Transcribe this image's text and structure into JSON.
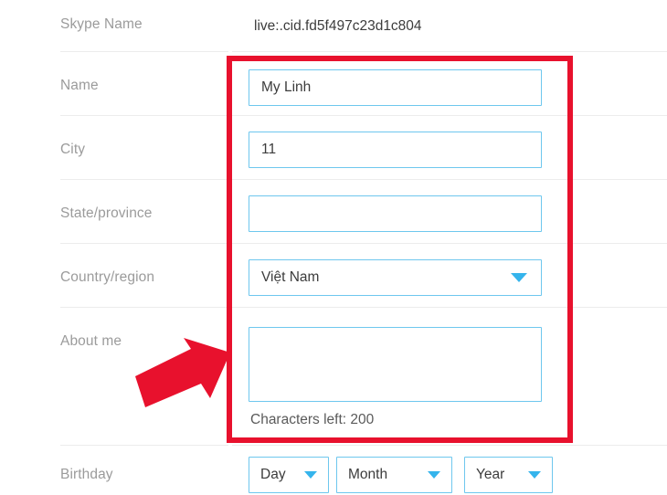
{
  "form": {
    "rows": [
      {
        "label": "Skype Name",
        "type": "static",
        "value": "live:.cid.fd5f497c23d1c804"
      },
      {
        "label": "Name",
        "type": "text",
        "value": "My Linh",
        "placeholder": ""
      },
      {
        "label": "City",
        "type": "text",
        "value": "11",
        "placeholder": ""
      },
      {
        "label": "State/province",
        "type": "text",
        "value": "",
        "placeholder": ""
      },
      {
        "label": "Country/region",
        "type": "select",
        "value": "Việt Nam"
      },
      {
        "label": "About me",
        "type": "textarea",
        "value": "",
        "helper": "Characters left: 200"
      },
      {
        "label": "Birthday",
        "type": "date-group"
      }
    ],
    "birthday": {
      "day": {
        "value": "Day"
      },
      "month": {
        "value": "Month"
      },
      "year": {
        "value": "Year"
      }
    }
  },
  "annotations": {
    "highlight_box": {
      "color": "#e8112d",
      "label": "red-highlight-rectangle"
    },
    "arrow": {
      "color": "#e8112d",
      "label": "red-pointer-arrow",
      "direction": "up-right"
    }
  },
  "colors": {
    "accent": "#35b4ec",
    "field_border": "#6ec7ee",
    "label_text": "#9b9b9b",
    "value_text": "#3c3c3c",
    "divider": "#ececec",
    "annotation_red": "#e8112d"
  }
}
